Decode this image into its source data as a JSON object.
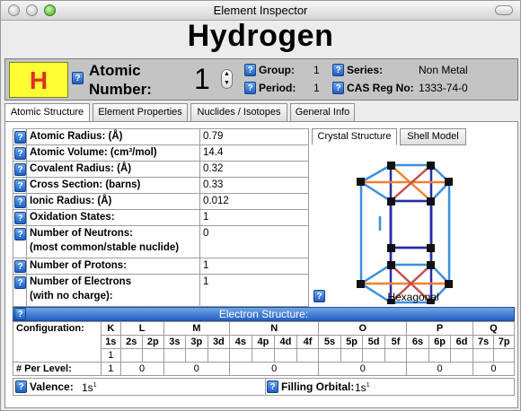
{
  "window": {
    "title": "Element Inspector"
  },
  "element": {
    "name": "Hydrogen",
    "symbol": "H",
    "atomic_number_label": "Atomic Number:",
    "atomic_number": "1"
  },
  "header": {
    "group_label": "Group:",
    "group_value": "1",
    "period_label": "Period:",
    "period_value": "1",
    "series_label": "Series:",
    "series_value": "Non Metal",
    "cas_label": "CAS Reg No:",
    "cas_value": "1333-74-0"
  },
  "tabs": [
    "Atomic Structure",
    "Element Properties",
    "Nuclides / Isotopes",
    "General Info"
  ],
  "properties": [
    {
      "label": "Atomic Radius: (Å)",
      "value": "0.79"
    },
    {
      "label": "Atomic Volume: (cm³/mol)",
      "value": "14.4"
    },
    {
      "label": "Covalent Radius: (Å)",
      "value": "0.32"
    },
    {
      "label": "Cross Section: (barns)",
      "value": "0.33"
    },
    {
      "label": "Ionic Radius: (Å)",
      "value": "0.012"
    },
    {
      "label": "Oxidation States:",
      "value": "1"
    },
    {
      "label": "Number of Neutrons:",
      "label2": "(most common/stable nuclide)",
      "value": "0"
    },
    {
      "label": "Number of Protons:",
      "value": "1"
    },
    {
      "label": "Number of Electrons",
      "label2": "(with no charge):",
      "value": "1"
    }
  ],
  "structure_tabs": [
    "Crystal Structure",
    "Shell Model"
  ],
  "crystal_label": "Hexagonal",
  "electron_structure": {
    "title": "Electron Structure:",
    "config_label": "Configuration:",
    "per_level_label": "# Per Level:",
    "shells": [
      "K",
      "L",
      "M",
      "N",
      "O",
      "P",
      "Q"
    ],
    "subshells": [
      "1s",
      "2s",
      "2p",
      "3s",
      "3p",
      "3d",
      "4s",
      "4p",
      "4d",
      "4f",
      "5s",
      "5p",
      "5d",
      "5f",
      "6s",
      "6p",
      "6d",
      "7s",
      "7p"
    ],
    "occupancy_1s": "1",
    "per_level": [
      "1",
      "0",
      "0",
      "0",
      "0",
      "0",
      "0"
    ],
    "valence_label": "Valence:",
    "valence_value": "1s",
    "valence_sup": "1",
    "filling_label": "Filling Orbital:",
    "filling_value": "1s",
    "filling_sup": "1"
  },
  "colors": {
    "symbol_bg": "#ffff33",
    "symbol_text": "#e0301e",
    "accent_blue": "#2460c4"
  }
}
